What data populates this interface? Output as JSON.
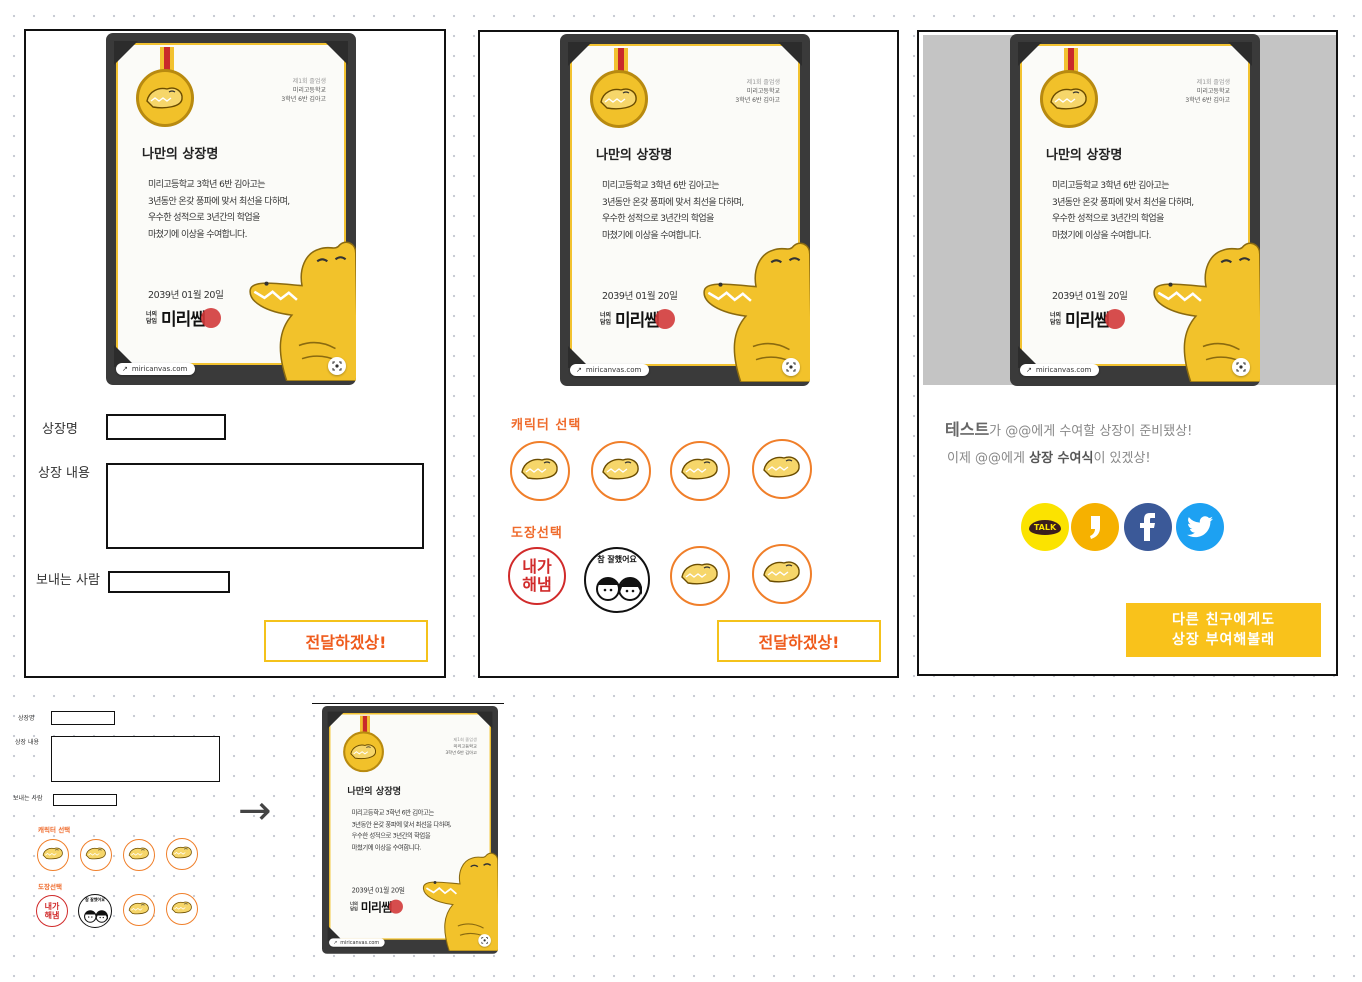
{
  "certificate": {
    "org_line1": "제1회 졸업생",
    "org_line2": "미리고등학교",
    "org_line3": "3학년 6반 김아고",
    "title": "나만의 상장명",
    "body_lines": [
      "미리고등학교 3학년 6반 김아고는",
      "3년동안 온갖 풍파에 맞서 최선을 다하며,",
      "우수한 성적으로 3년간의 학업을",
      "마쳤기에 이상을 수여합니다."
    ],
    "date": "2039년 01월 20일",
    "brand_small_1": "너의",
    "brand_small_2": "담임",
    "brand_big": "미리쌤",
    "link": "miricanvas.com"
  },
  "form": {
    "award_name_label": "상장명",
    "award_content_label": "상장 내용",
    "sender_label": "보내는 사람",
    "award_name_value": "",
    "award_content_value": "",
    "sender_value": ""
  },
  "selection": {
    "character_label": "캐릭터 선택",
    "stamp_label": "도장선택",
    "stamp_text_1": "내가",
    "stamp_text_2": "해냄",
    "stamp_text_3": "참 잘했어요"
  },
  "submit_label": "전달하겠상!",
  "result": {
    "line1_bold": "테스트",
    "line1_rest": "가 @@에게 수여할 상장이 준비됐상!",
    "line2_pre": "이제 @@에게 ",
    "line2_bold": "상장 수여식",
    "line2_post": "이 있겠상!",
    "share_icons": [
      "kakaotalk-icon",
      "kakaostory-icon",
      "facebook-icon",
      "twitter-icon"
    ],
    "kakao_talk_text": "TALK",
    "again_line1": "다른 친구에게도",
    "again_line2": "상장 부여해볼래"
  },
  "arrow_glyph": "→",
  "colors": {
    "accent_orange": "#ef5b1c",
    "yellow": "#f4c21b",
    "kakao": "#fbe300",
    "kakaostory": "#f6b100",
    "facebook": "#3b5998",
    "twitter": "#1da1f2"
  }
}
